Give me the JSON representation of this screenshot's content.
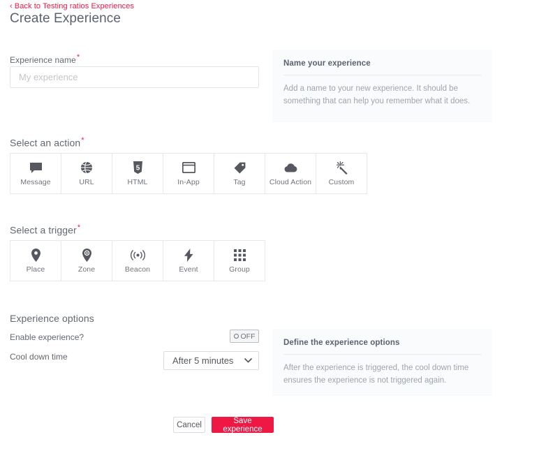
{
  "header": {
    "back_link": "Back to Testing ratios Experiences",
    "back_chevron": "‹",
    "title": "Create Experience"
  },
  "name_field": {
    "label": "Experience name",
    "required_mark": "*",
    "value": "",
    "placeholder": "My experience"
  },
  "info_name": {
    "title": "Name your experience",
    "body": "Add a name to your new experience. It should be something that can help you remember what it does."
  },
  "action_section": {
    "label": "Select an action",
    "required_mark": "*",
    "cards": [
      {
        "label": "Message",
        "icon": "message-icon"
      },
      {
        "label": "URL",
        "icon": "globe-icon"
      },
      {
        "label": "HTML",
        "icon": "html5-icon"
      },
      {
        "label": "In-App",
        "icon": "window-icon"
      },
      {
        "label": "Tag",
        "icon": "tag-icon"
      },
      {
        "label": "Cloud Action",
        "icon": "cloud-icon"
      },
      {
        "label": "Custom",
        "icon": "magic-wand-icon"
      }
    ]
  },
  "trigger_section": {
    "label": "Select a trigger",
    "required_mark": "*",
    "cards": [
      {
        "label": "Place",
        "icon": "map-pin-icon"
      },
      {
        "label": "Zone",
        "icon": "map-pin-circle-icon"
      },
      {
        "label": "Beacon",
        "icon": "beacon-icon"
      },
      {
        "label": "Event",
        "icon": "lightning-bolt-icon"
      },
      {
        "label": "Group",
        "icon": "grid-icon"
      }
    ]
  },
  "options_section": {
    "heading": "Experience options",
    "enable_label": "Enable experience?",
    "enable_state": "OFF",
    "cooldown_label": "Cool down time",
    "cooldown_value": "After 5 minutes",
    "chevron": "⌄"
  },
  "info_options": {
    "title": "Define the experience options",
    "body": "After the experience is triggered, the cool down time ensures the experience is not triggered again."
  },
  "footer": {
    "cancel_label": "Cancel",
    "save_label": "Save experience"
  },
  "colors": {
    "accent": "#ED1944",
    "text": "#62686f",
    "muted": "#9ea4ac",
    "panel_bg": "#fafbfd",
    "border": "#e6e8eb"
  }
}
